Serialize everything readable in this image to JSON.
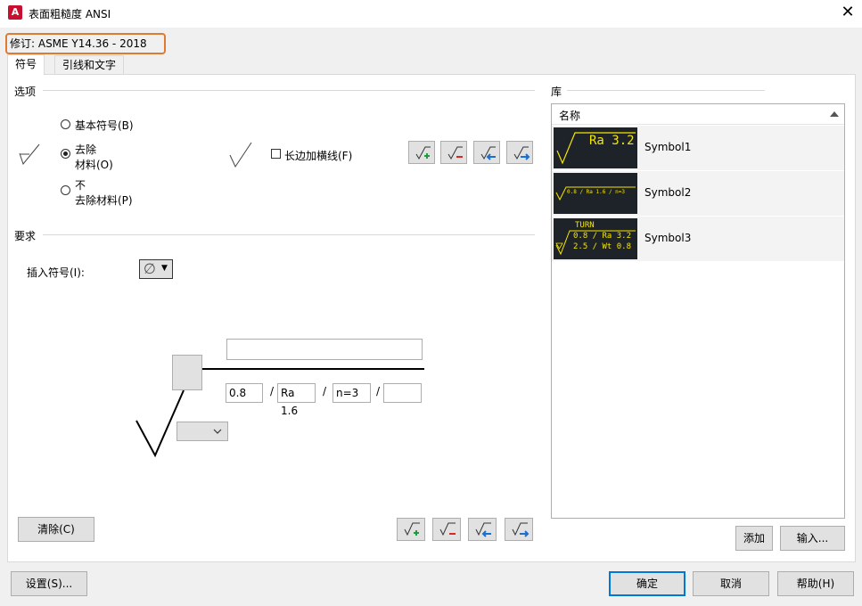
{
  "window": {
    "app_icon": "A",
    "title": "表面粗糙度 ANSI",
    "close": "✕"
  },
  "revision": "修订: ASME Y14.36 - 2018",
  "tabs": [
    {
      "label": "符号"
    },
    {
      "label": "引线和文字"
    }
  ],
  "options": {
    "heading": "选项",
    "radio_basic": "基本符号(B)",
    "radio_remove_1": "去除",
    "radio_remove_2": "材料(O)",
    "radio_noremove_1": "不",
    "radio_noremove_2": "去除材料(P)",
    "checkbox_longbar": "长边加横线(F)"
  },
  "requirements": {
    "heading": "要求",
    "insert_label": "插入符号(I):",
    "insert_symbol": "∅",
    "fields": {
      "top": "",
      "a": "0.8",
      "b": "Ra 1.6",
      "c": "n=3",
      "d": ""
    },
    "slash": "/"
  },
  "library": {
    "heading": "库",
    "column": "名称",
    "items": [
      {
        "name": "Symbol1",
        "thumb": [
          "Ra 3.2"
        ]
      },
      {
        "name": "Symbol2",
        "thumb": [
          "0.8 / Ra 1.6 / n=3"
        ]
      },
      {
        "name": "Symbol3",
        "thumb": [
          "TURN",
          "0.8 / Ra 3.2",
          "2.5 / Wt 0.8"
        ]
      }
    ],
    "add": "添加",
    "import": "输入..."
  },
  "buttons": {
    "clear": "清除(C)",
    "settings": "设置(S)...",
    "ok": "确定",
    "cancel": "取消",
    "help": "帮助(H)"
  },
  "colors": {
    "accent": "#0078d7",
    "highlight": "#e07a2e",
    "thumb_bg": "#1e2329",
    "thumb_fg": "#f5e600"
  }
}
